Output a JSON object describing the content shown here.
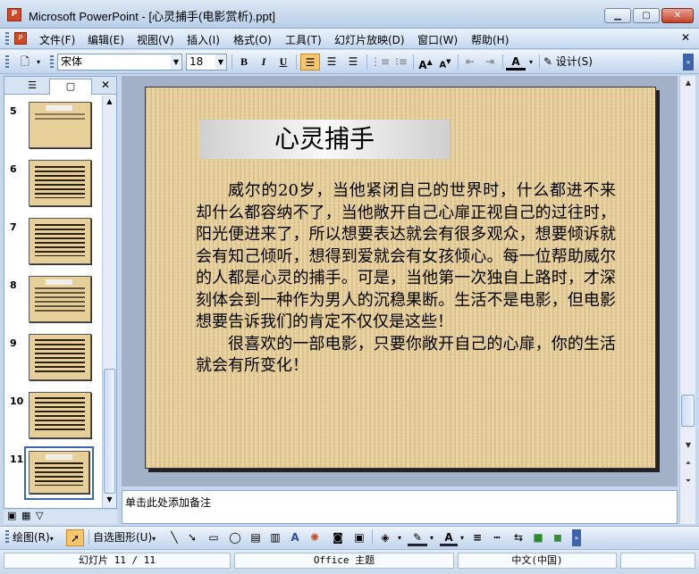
{
  "window": {
    "title": "Microsoft PowerPoint - [心灵捕手(电影赏析).ppt]",
    "app_icon": "powerpoint-icon"
  },
  "menubar": {
    "items": [
      "文件(F)",
      "编辑(E)",
      "视图(V)",
      "插入(I)",
      "格式(O)",
      "工具(T)",
      "幻灯片放映(D)",
      "窗口(W)",
      "帮助(H)"
    ]
  },
  "toolbar": {
    "font_name": "宋体",
    "font_size": "18",
    "design_label": "设计(S)"
  },
  "thumbnails": [
    {
      "num": "5"
    },
    {
      "num": "6"
    },
    {
      "num": "7"
    },
    {
      "num": "8"
    },
    {
      "num": "9"
    },
    {
      "num": "10"
    },
    {
      "num": "11"
    }
  ],
  "slide": {
    "title": "心灵捕手",
    "paragraph1": "威尔的20岁，当他紧闭自己的世界时，什么都进不来却什么都容纳不了，当他敞开自己心扉正视自己的过往时，阳光便进来了，所以想要表达就会有很多观众，想要倾诉就会有知己倾听，想得到爱就会有女孩倾心。每一位帮助威尔的人都是心灵的捕手。可是，当他第一次独自上路时，才深刻体会到一种作为男人的沉稳果断。生活不是电影，但电影想要告诉我们的肯定不仅仅是这些！",
    "paragraph2": "很喜欢的一部电影，只要你敞开自己的心扉，你的生活就会有所变化！"
  },
  "notes": {
    "placeholder": "单击此处添加备注"
  },
  "drawbar": {
    "draw_label": "绘图(R)",
    "autoshapes_label": "自选图形(U)"
  },
  "status": {
    "slide": "幻灯片 11 / 11",
    "theme": "Office 主题",
    "language": "中文(中国)"
  }
}
